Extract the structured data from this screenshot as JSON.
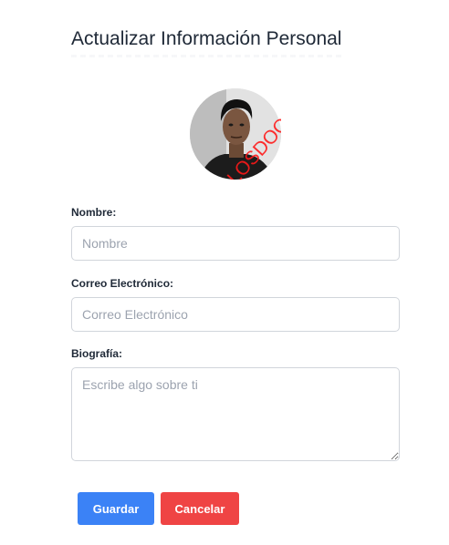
{
  "page": {
    "title": "Actualizar Información Personal"
  },
  "avatar": {
    "description_icon": "profile-photo",
    "watermark_text": "LOSDOOR"
  },
  "form": {
    "name": {
      "label": "Nombre:",
      "placeholder": "Nombre",
      "value": ""
    },
    "email": {
      "label": "Correo Electrónico:",
      "placeholder": "Correo Electrónico",
      "value": ""
    },
    "bio": {
      "label": "Biografía:",
      "placeholder": "Escribe algo sobre ti",
      "value": ""
    }
  },
  "actions": {
    "save_label": "Guardar",
    "cancel_label": "Cancelar",
    "save_color": "#3b82f6",
    "cancel_color": "#ef4444"
  }
}
